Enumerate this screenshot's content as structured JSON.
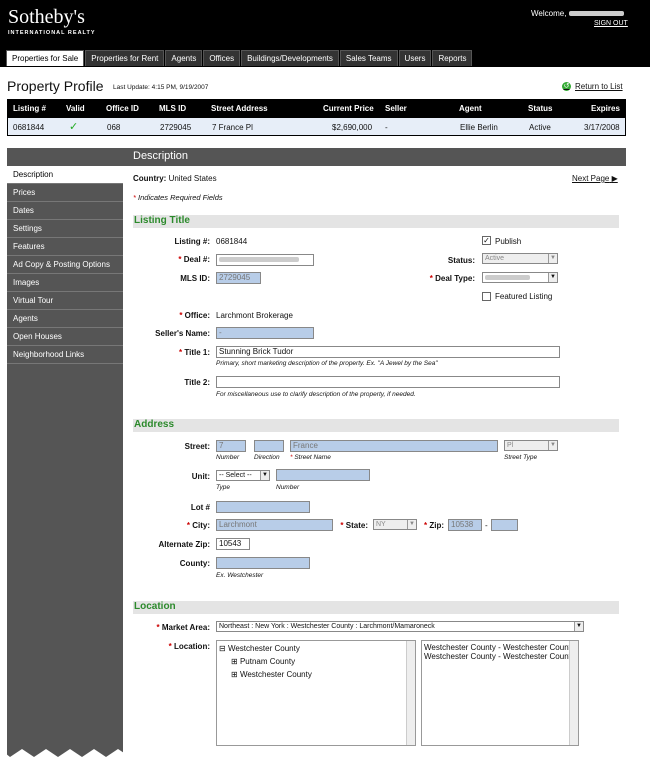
{
  "header": {
    "logo": "Sotheby's",
    "logo_sub": "INTERNATIONAL REALTY",
    "welcome": "Welcome,",
    "signout": "SIGN OUT"
  },
  "tabs": [
    "Properties for Sale",
    "Properties for Rent",
    "Agents",
    "Offices",
    "Buildings/Developments",
    "Sales Teams",
    "Users",
    "Reports"
  ],
  "page": {
    "title": "Property Profile",
    "last_update": "Last Update: 4:15 PM, 9/19/2007",
    "return": "Return to List"
  },
  "summary": {
    "headers": [
      "Listing #",
      "Valid",
      "Office ID",
      "MLS ID",
      "Street Address",
      "Current Price",
      "Seller",
      "Agent",
      "Status",
      "Expires"
    ],
    "row": {
      "listing": "0681844",
      "valid": "✓",
      "office": "068",
      "mls": "2729045",
      "street": "7 France Pl",
      "price": "$2,690,000",
      "seller": "-",
      "agent": "Ellie Berlin",
      "status": "Active",
      "expires": "3/17/2008"
    }
  },
  "section_header": "Description",
  "sidebar": [
    "Description",
    "Prices",
    "Dates",
    "Settings",
    "Features",
    "Ad Copy & Posting Options",
    "Images",
    "Virtual Tour",
    "Agents",
    "Open Houses",
    "Neighborhood Links"
  ],
  "form": {
    "country_label": "Country:",
    "country": "United States",
    "next_page": "Next Page",
    "required_star": "*",
    "required_note": "Indicates Required Fields",
    "listing_title": "Listing Title",
    "listing_no_label": "Listing #:",
    "listing_no": "0681844",
    "deal_label": "Deal #:",
    "mls_label": "MLS ID:",
    "mls": "2729045",
    "publish": "Publish",
    "status_label": "Status:",
    "status": "Active",
    "deal_type_label": "Deal Type:",
    "featured": "Featured Listing",
    "office_label": "Office:",
    "office": "Larchmont Brokerage",
    "seller_label": "Seller's Name:",
    "seller": "-",
    "title1_label": "Title 1:",
    "title1": "Stunning Brick Tudor",
    "title1_hint": "Primary, short marketing description of the property. Ex. \"A Jewel by the Sea\"",
    "title2_label": "Title 2:",
    "title2_hint": "For miscellaneous use to clarify description of the property, if needed.",
    "address": "Address",
    "street_label": "Street:",
    "street_no": "7",
    "street_name": "France",
    "street_type": "Pl",
    "number_hint": "Number",
    "direction_hint": "Direction",
    "street_name_hint": "Street Name",
    "street_type_hint": "Street Type",
    "unit_label": "Unit:",
    "unit_select": "-- Select --",
    "type_hint": "Type",
    "lot_label": "Lot #",
    "city_label": "City:",
    "city": "Larchmont",
    "state_label": "State:",
    "state": "NY",
    "zip_label": "Zip:",
    "zip": "10538",
    "zip_dash": "-",
    "alt_zip_label": "Alternate Zip:",
    "alt_zip": "10543",
    "county_label": "County:",
    "county_hint": "Ex. Westchester",
    "location": "Location",
    "market_label": "Market Area:",
    "market": "Northeast : New York : Westchester County : Larchmont/Mamaroneck",
    "location_label": "Location:",
    "tree": [
      "Westchester County",
      "Putnam County",
      "Westchester County"
    ],
    "tree_signs": [
      "⊟",
      "⊞",
      "⊞"
    ],
    "selected": [
      "Westchester County - Westchester County - Sch",
      "Westchester County - Westchester County - Tow"
    ]
  }
}
